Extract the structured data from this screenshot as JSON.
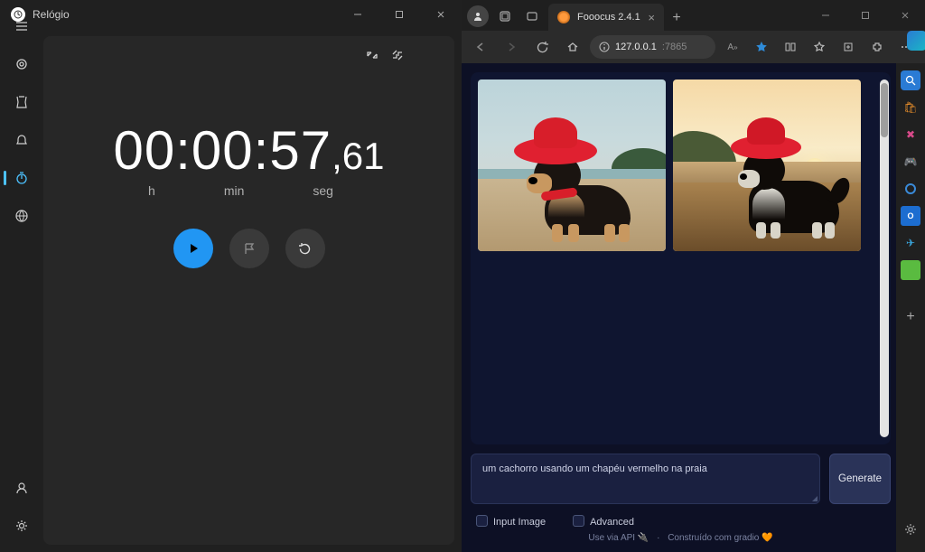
{
  "clock": {
    "title": "Relógio",
    "time": {
      "hms": "00:00:57",
      "comma": ",",
      "cs": "61"
    },
    "labels": {
      "h": "h",
      "min": "min",
      "seg": "seg"
    }
  },
  "browser": {
    "tab": {
      "title": "Fooocus 2.4.1"
    },
    "url": {
      "host": "127.0.0.1",
      "port": ":7865"
    },
    "prompt": "um cachorro usando um chapéu vermelho na praia",
    "generate": "Generate",
    "options": {
      "input_image": "Input Image",
      "advanced": "Advanced"
    },
    "footer": {
      "api": "Use via API 🔌",
      "gradio": "Construído com gradio 🧡"
    }
  }
}
